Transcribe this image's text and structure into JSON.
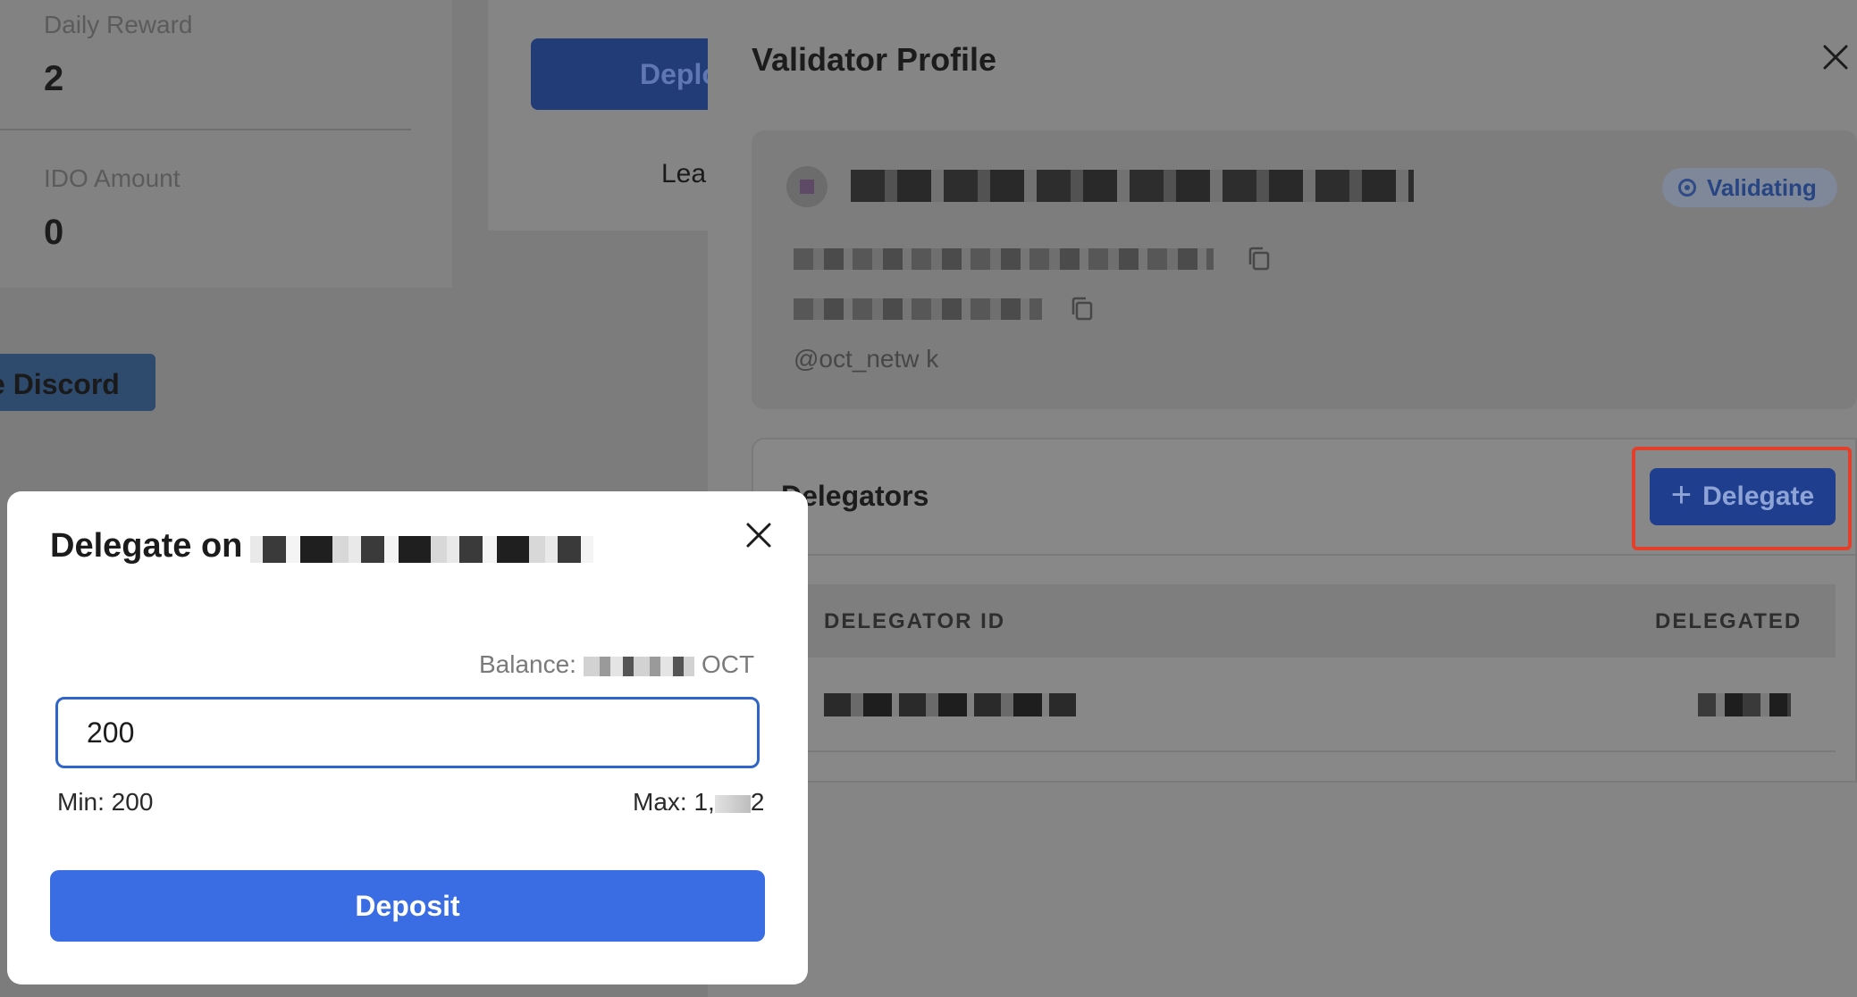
{
  "background": {
    "stats": [
      {
        "label": "Daily Reward",
        "value": "2"
      },
      {
        "label": "IDO Amount",
        "value": "0"
      }
    ],
    "deploy_label": "Deplo",
    "learn_label": "Lea",
    "discord_label": "e Discord"
  },
  "validator_drawer": {
    "title": "Validator Profile",
    "status": "Validating",
    "twitter": "@oct_netw   k",
    "delegators_title": "Delegators",
    "delegate_button": "Delegate",
    "table": {
      "headers": [
        "DELEGATOR ID",
        "DELEGATED"
      ]
    }
  },
  "modal": {
    "title": "Delegate on",
    "balance_label": "Balance:",
    "balance_unit": "OCT",
    "amount_value": "200",
    "min_label": "Min: 200",
    "max_label": "Max: 1,",
    "max_suffix": "2",
    "deposit_button": "Deposit"
  },
  "colors": {
    "primary": "#3a6de3",
    "highlight": "#e2402a",
    "overlay": "#808080"
  }
}
